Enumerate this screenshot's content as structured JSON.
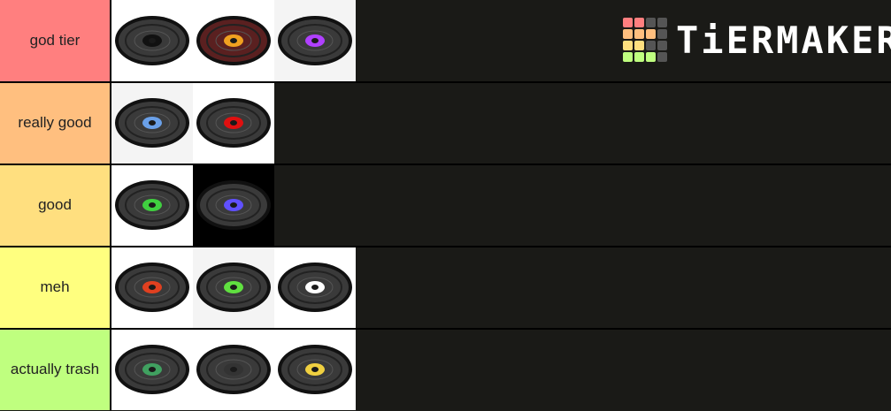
{
  "logo": {
    "text": "TiERMAKER"
  },
  "tiers": [
    {
      "label": "god tier",
      "color": "#ff7f7f",
      "items": [
        {
          "icon": "music-disc-black-icon",
          "center": "#111111",
          "bg": "white"
        },
        {
          "icon": "music-disc-orange-icon",
          "center": "#f0a020",
          "bg": "white",
          "disc": "#5a2020"
        },
        {
          "icon": "music-disc-purple-icon",
          "center": "#b040ff",
          "bg": "offwhite"
        }
      ]
    },
    {
      "label": "really good",
      "color": "#ffbf7f",
      "items": [
        {
          "icon": "music-disc-light-blue-icon",
          "center": "#6aa0e8",
          "bg": "offwhite"
        },
        {
          "icon": "music-disc-red-icon",
          "center": "#e01010",
          "bg": "white"
        }
      ]
    },
    {
      "label": "good",
      "color": "#ffdf7f",
      "items": [
        {
          "icon": "music-disc-green-icon",
          "center": "#40d040",
          "bg": "white"
        },
        {
          "icon": "music-disc-blue-violet-icon",
          "center": "#6050ff",
          "bg": "black"
        }
      ]
    },
    {
      "label": "meh",
      "color": "#ffff7f",
      "items": [
        {
          "icon": "music-disc-red-orange-icon",
          "center": "#e04020",
          "bg": "white"
        },
        {
          "icon": "music-disc-lime-icon",
          "center": "#60e040",
          "bg": "offwhite"
        },
        {
          "icon": "music-disc-white-icon",
          "center": "#ffffff",
          "bg": "white"
        }
      ]
    },
    {
      "label": "actually trash",
      "color": "#bfff7f",
      "items": [
        {
          "icon": "music-disc-teal-icon",
          "center": "#40a060",
          "bg": "white"
        },
        {
          "icon": "music-disc-fragments-icon",
          "center": "#333333",
          "bg": "white"
        },
        {
          "icon": "music-disc-yellow-white-icon",
          "center": "#f0d040",
          "bg": "white"
        }
      ]
    }
  ]
}
